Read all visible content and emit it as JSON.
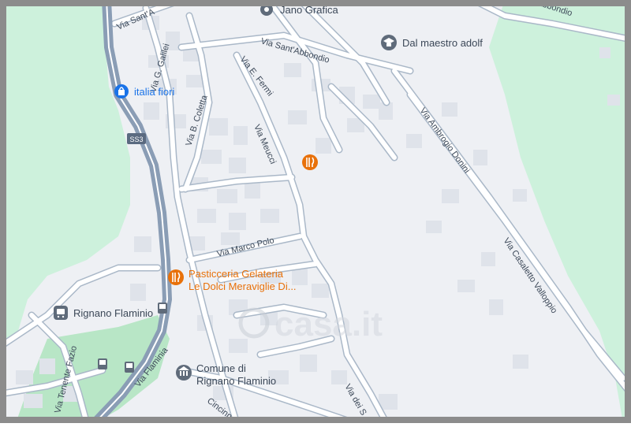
{
  "colors": {
    "land": "#eef0f4",
    "green": "#cdf1dc",
    "park": "#b8e6c6",
    "road": "#ffffff",
    "road_casing": "#aab8c8",
    "highway": "#8a9db5",
    "building": "#dfe3ea",
    "label": "#3c4858",
    "poi_orange": "#e8710a",
    "poi_blue": "#1a73e8",
    "poi_gray": "#5f6b7a",
    "frame": "#8c8c8c"
  },
  "streets": {
    "sant_abbondio_top": "Via Sant'A",
    "sant_abbondio": "Via Sant'Abbondio",
    "abbondio_right": "Abbondio",
    "galilei": "Via G. Galilei",
    "fermi": "Via E. Fermi",
    "coletta": "Via B. Coletta",
    "meucci": "Via Meucci",
    "marco_polo": "Via Marco Polo",
    "donini": "Via Ambrogio Donini",
    "casaletto": "Via Casaletto Valloppio",
    "flaminia": "Via Flaminia",
    "tenente_fazio": "Via Tenente Fazio",
    "dei_s": "Via dei S",
    "cincinn": "Cincinn",
    "ss3": "SS3"
  },
  "pois": {
    "jano": {
      "name": "Jano Grafica",
      "icon": "pin-icon"
    },
    "maestro": {
      "name": "Dal maestro adolf",
      "icon": "school-icon"
    },
    "italia_fiori": {
      "name": "italia fiori",
      "icon": "shopping-bag-icon"
    },
    "restaurant": {
      "icon": "fork-knife-icon"
    },
    "pasticceria": {
      "line1": "Pasticceria Gelateria",
      "line2": "Le Dolci Meraviglie Di...",
      "icon": "fork-knife-icon"
    },
    "rignano": {
      "name": "Rignano Flaminio",
      "icon": "train-icon"
    },
    "comune": {
      "line1": "Comune di",
      "line2": "Rignano Flaminio",
      "icon": "town-hall-icon"
    }
  },
  "watermark": "casa.it"
}
